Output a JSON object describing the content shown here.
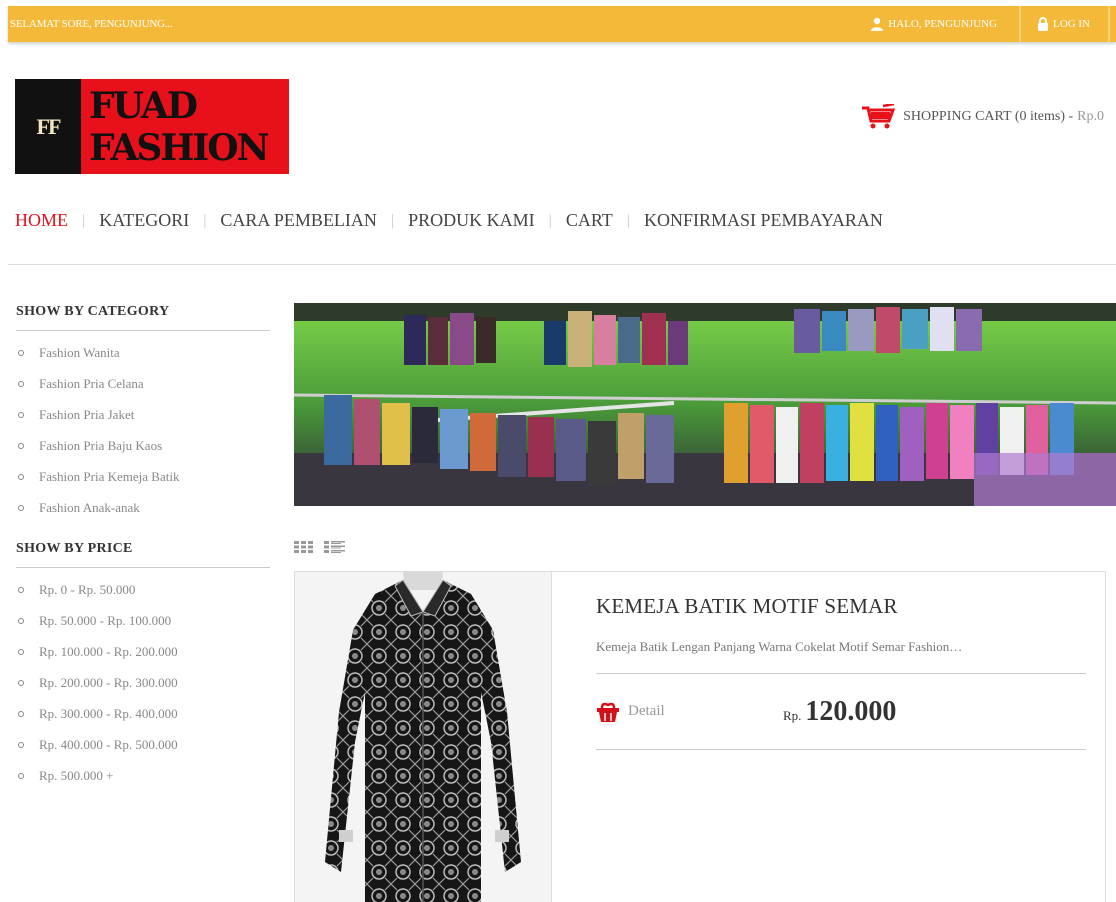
{
  "topbar": {
    "greeting": "SELAMAT SORE, PENGUNJUNG...",
    "user_label": "HALO,  PENGUNJUNG",
    "login_label": "LOG IN"
  },
  "logo": {
    "mark": "FF",
    "name": "FUAD FASHION"
  },
  "cart": {
    "label": "SHOPPING CART (0 items) - ",
    "amount": "Rp.0"
  },
  "nav": {
    "items": [
      "HOME",
      "KATEGORI",
      "CARA PEMBELIAN",
      "PRODUK KAMI",
      "CART",
      "KONFIRMASI PEMBAYARAN"
    ],
    "active": "HOME"
  },
  "sidebar": {
    "category_title": "SHOW BY CATEGORY",
    "categories": [
      "Fashion Wanita",
      "Fashion Pria Celana",
      "Fashion Pria Jaket",
      "Fashion Pria Baju Kaos",
      "Fashion Pria Kemeja Batik",
      "Fashion Anak-anak"
    ],
    "price_title": "SHOW BY PRICE",
    "prices": [
      "Rp. 0 - Rp. 50.000",
      "Rp. 50.000 - Rp. 100.000",
      "Rp. 100.000 - Rp. 200.000",
      "Rp. 200.000 - Rp. 300.000",
      "Rp. 300.000 - Rp. 400.000",
      "Rp. 400.000 - Rp. 500.000",
      "Rp. 500.000 +"
    ]
  },
  "product": {
    "title": "KEMEJA BATIK MOTIF SEMAR",
    "description": "Kemeja Batik Lengan Panjang Warna Cokelat Motif Semar Fashion…",
    "detail_label": "Detail",
    "currency": "Rp.",
    "price": "120.000"
  },
  "colors": {
    "topbar": "#f5b93a",
    "accent": "#e8101a"
  }
}
